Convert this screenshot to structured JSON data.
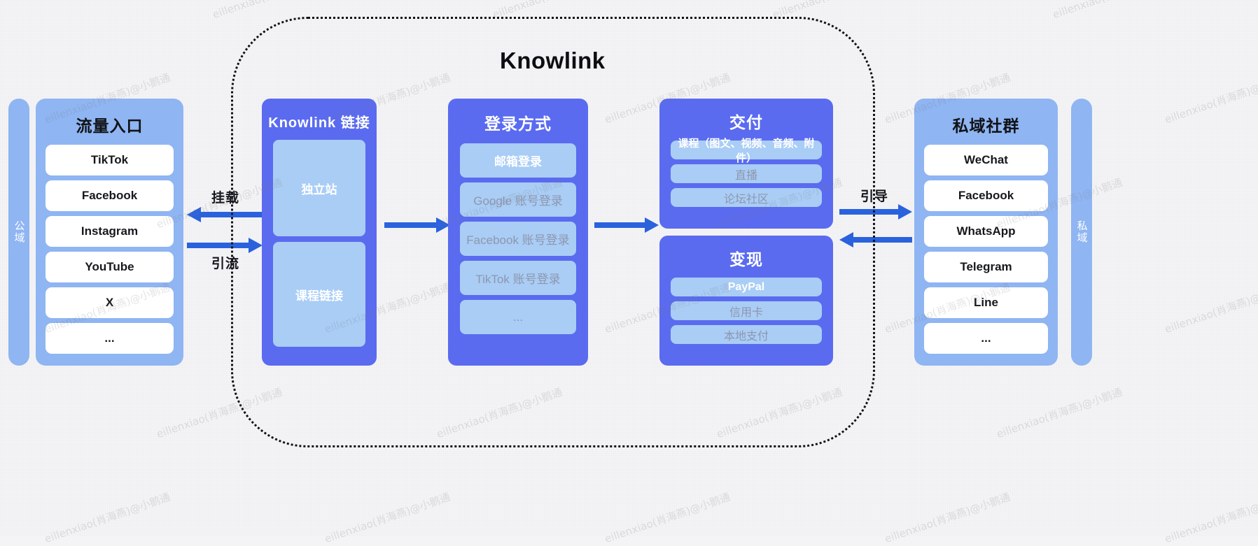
{
  "diagram": {
    "center_title": "Knowlink",
    "public_bar": {
      "label": "公域"
    },
    "private_bar": {
      "label": "私域"
    },
    "columns": {
      "traffic": {
        "title": "流量入口",
        "items": [
          "TikTok",
          "Facebook",
          "Instagram",
          "YouTube",
          "X",
          "..."
        ]
      },
      "knowlink_link": {
        "title": "Knowlink 链接",
        "items": [
          "独立站",
          "课程链接"
        ]
      },
      "login": {
        "title": "登录方式",
        "items": [
          {
            "label": "邮箱登录",
            "state": "on"
          },
          {
            "label": "Google 账号登录",
            "state": "off"
          },
          {
            "label": "Facebook 账号登录",
            "state": "off"
          },
          {
            "label": "TikTok 账号登录",
            "state": "off"
          },
          {
            "label": "...",
            "state": "off"
          }
        ]
      },
      "delivery": {
        "title": "交付",
        "items": [
          {
            "label": "课程（图文、视频、音频、附件）",
            "state": "on"
          },
          {
            "label": "直播",
            "state": "off"
          },
          {
            "label": "论坛社区",
            "state": "off"
          }
        ]
      },
      "monetize": {
        "title": "变现",
        "items": [
          {
            "label": "PayPal",
            "state": "on"
          },
          {
            "label": "信用卡",
            "state": "off"
          },
          {
            "label": "本地支付",
            "state": "off"
          }
        ]
      },
      "community": {
        "title": "私域社群",
        "items": [
          "WeChat",
          "Facebook",
          "WhatsApp",
          "Telegram",
          "Line",
          "..."
        ]
      }
    },
    "arrows": {
      "mount_label": "挂载",
      "traffic_label": "引流",
      "guide_label": "引导"
    },
    "colors": {
      "background": "#f4f4f6",
      "light_blue": "#8fb5f2",
      "deep_blue": "#5a6bf0",
      "item_blue": "#a9cdf5",
      "arrow_blue": "#2a62dd",
      "white": "#ffffff",
      "text_dark": "#16181d",
      "text_muted": "#8e96ae"
    },
    "watermark": "eillenxiao(肖海燕)@小鹅通"
  }
}
